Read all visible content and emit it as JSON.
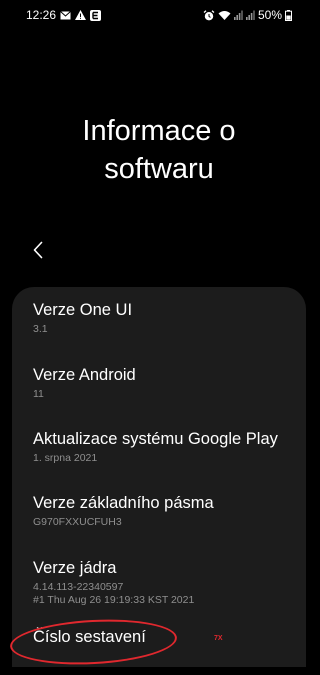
{
  "status_bar": {
    "time": "12:26",
    "icons_left": [
      "mail-icon",
      "warning-icon",
      "e-icon"
    ],
    "icons_right": [
      "alarm-icon",
      "wifi-icon",
      "signal-icon",
      "signal-icon-2"
    ],
    "battery": "50%"
  },
  "page": {
    "title": "Informace o softwaru"
  },
  "back": {
    "icon": "chevron-left-icon"
  },
  "items": [
    {
      "title": "Verze One UI",
      "sub": "3.1"
    },
    {
      "title": "Verze Android",
      "sub": "11"
    },
    {
      "title": "Aktualizace systému Google Play",
      "sub": "1. srpna 2021"
    },
    {
      "title": "Verze základního pásma",
      "sub": "G970FXXUCFUH3"
    },
    {
      "title": "Verze jádra",
      "sub": "4.14.113-22340597",
      "sub2": "#1 Thu Aug 26 19:19:33 KST 2021"
    },
    {
      "title": "Číslo sestavení"
    }
  ],
  "annotation": {
    "tap_count": "7X",
    "color": "#e0282e"
  },
  "colors": {
    "background": "#000000",
    "card": "#1c1c1c",
    "secondary_text": "#8f8f8f"
  }
}
